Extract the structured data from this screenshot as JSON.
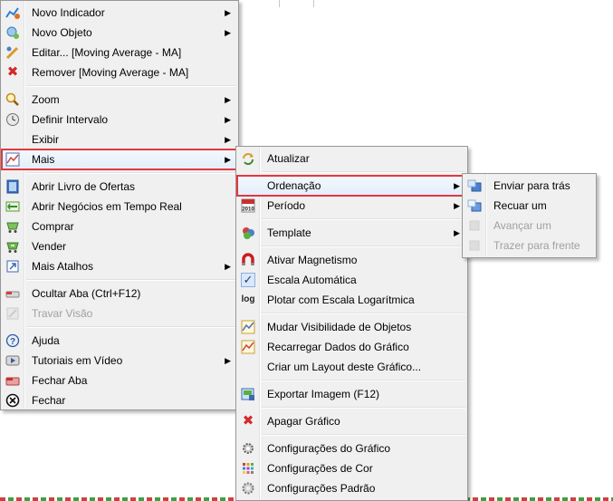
{
  "main_menu": {
    "items": [
      {
        "label": "Novo Indicador",
        "icon": "new-indicator-icon"
      },
      {
        "label": "Novo Objeto",
        "icon": "new-object-icon"
      },
      {
        "label": "Editar... [Moving Average - MA]",
        "icon": "edit-icon"
      },
      {
        "label": "Remover [Moving Average - MA]",
        "icon": "remove-icon"
      },
      {
        "label": "Zoom",
        "icon": "zoom-icon"
      },
      {
        "label": "Definir Intervalo",
        "icon": "clock-icon"
      },
      {
        "label": "Exibir"
      },
      {
        "label": "Mais",
        "icon": "chart-icon"
      },
      {
        "label": "Abrir Livro de Ofertas",
        "icon": "book-icon"
      },
      {
        "label": "Abrir Negócios em Tempo Real",
        "icon": "trades-icon"
      },
      {
        "label": "Comprar",
        "icon": "buy-icon"
      },
      {
        "label": "Vender",
        "icon": "sell-icon"
      },
      {
        "label": "Mais Atalhos",
        "icon": "shortcut-icon"
      },
      {
        "label": "Ocultar Aba (Ctrl+F12)",
        "icon": "hide-tab-icon"
      },
      {
        "label": "Travar Visão",
        "icon": "lock-view-icon"
      },
      {
        "label": "Ajuda",
        "icon": "help-icon"
      },
      {
        "label": "Tutoriais em Vídeo",
        "icon": "video-icon"
      },
      {
        "label": "Fechar Aba",
        "icon": "close-tab-icon"
      },
      {
        "label": "Fechar",
        "icon": "close-icon"
      }
    ]
  },
  "sub_menu": {
    "items": [
      {
        "label": "Atualizar",
        "icon": "refresh-icon"
      },
      {
        "label": "Ordenação"
      },
      {
        "label": "Período",
        "icon": "calendar-icon",
        "icon_text": "2010"
      },
      {
        "label": "Template",
        "icon": "template-icon"
      },
      {
        "label": "Ativar Magnetismo",
        "icon": "magnet-icon"
      },
      {
        "label": "Escala Automática",
        "icon": "checkmark-icon"
      },
      {
        "label": "Plotar com Escala Logarítmica",
        "icon": "log-icon",
        "icon_text": "log"
      },
      {
        "label": "Mudar Visibilidade de Objetos",
        "icon": "visibility-icon"
      },
      {
        "label": "Recarregar Dados do Gráfico",
        "icon": "reload-icon"
      },
      {
        "label": "Criar um Layout deste Gráfico..."
      },
      {
        "label": "Exportar Imagem (F12)",
        "icon": "export-icon"
      },
      {
        "label": "Apagar Gráfico",
        "icon": "delete-icon"
      },
      {
        "label": "Configurações do Gráfico",
        "icon": "chart-settings-icon"
      },
      {
        "label": "Configurações de Cor",
        "icon": "color-settings-icon"
      },
      {
        "label": "Configurações Padrão",
        "icon": "default-settings-icon"
      }
    ]
  },
  "order_menu": {
    "items": [
      {
        "label": "Enviar para trás",
        "icon": "send-back-icon"
      },
      {
        "label": "Recuar um",
        "icon": "backward-icon"
      },
      {
        "label": "Avançar um",
        "icon": "forward-icon"
      },
      {
        "label": "Trazer para frente",
        "icon": "bring-front-icon"
      }
    ]
  },
  "arrow_glyph": "▶",
  "colors": {
    "highlight": "#e0393e",
    "menu_bg": "#f0f0f0",
    "disabled": "#a0a0a0"
  }
}
